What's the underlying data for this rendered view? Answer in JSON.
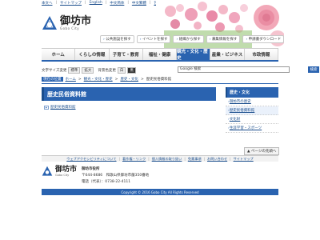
{
  "utility": {
    "items": [
      "本文へ",
      "サイトマップ",
      "English",
      "中文简体",
      "中文繁體",
      "한국어"
    ]
  },
  "site": {
    "title": "御坊市",
    "subtitle": "Gobo City"
  },
  "quick_links": [
    "公共施設を探す",
    "イベントを探す",
    "組織から探す",
    "募集情報を探す",
    "申請書ダウンロード"
  ],
  "global_nav": [
    {
      "label": "ホーム"
    },
    {
      "label": "くらしの情報"
    },
    {
      "label": "子育て・教育"
    },
    {
      "label": "福祉・健康"
    },
    {
      "label": "観光・文化・歴史"
    },
    {
      "label": "産業・ビジネス"
    },
    {
      "label": "市政情報"
    }
  ],
  "tools": {
    "font_size_label": "文字サイズ変更",
    "font_std": "標準",
    "font_large": "拡大",
    "bg_label": "背景色変更",
    "bg_white": "白",
    "bg_black": "黒",
    "search_value": "Google 検索",
    "search_button": "検索"
  },
  "breadcrumb": {
    "here_label": "現在の位置",
    "items": [
      "ホーム",
      "観光・文化・歴史",
      "歴史・文化",
      "歴史民俗資料館"
    ]
  },
  "page": {
    "title": "歴史民俗資料館",
    "link": "歴史民俗資料館"
  },
  "sidebar": {
    "title": "歴史・文化",
    "items": [
      "御坊市の歴史",
      "歴史民俗資料館",
      "文化財",
      "生涯学習・スポーツ"
    ]
  },
  "page_top": "ページの先頭へ",
  "footer_nav": [
    "ウェブアクセシビリティについて",
    "著作権・リンク",
    "個人情報の取り扱い",
    "免責事項",
    "お問い合わせ",
    "サイトマップ"
  ],
  "footer": {
    "org": "御坊市役所",
    "address": "〒644-8686　和歌山県御坊市薗350番地",
    "phone": "電話（代表）：0738-22-4111",
    "copyright": "Copyright © 2016 Gobo City All Rights Reserved"
  },
  "colors": {
    "accent": "#2a63b0",
    "accent_dark": "#1a4d8c"
  }
}
